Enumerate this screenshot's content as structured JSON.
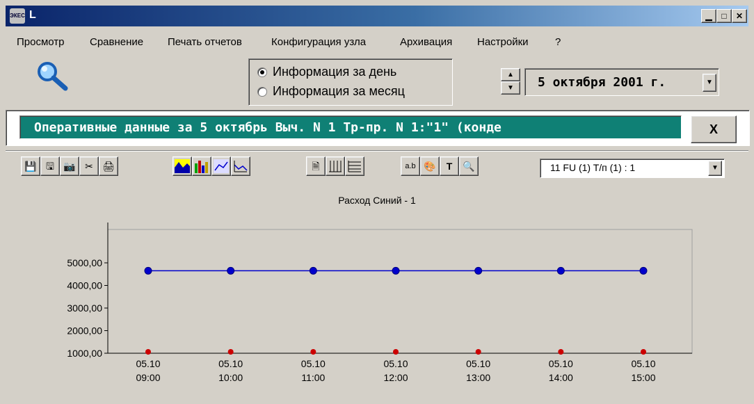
{
  "window": {
    "title": "L",
    "app_icon": "ЭКЕС"
  },
  "menu": [
    "Просмотр",
    "Сравнение",
    "Печать отчетов",
    "Конфигурация узла",
    "Архивация",
    "Настройки",
    "?"
  ],
  "period": {
    "options": [
      "Информация за день",
      "Информация за месяц"
    ],
    "selected": "Информация за день"
  },
  "date": {
    "value": "5  октября  2001 г."
  },
  "info": {
    "text": "Оперативные данные за 5 октябрь Выч. N 1 Тр-пр. N 1:\"1\" (конде",
    "close_label": "X"
  },
  "toolbar": {
    "icons": [
      "save-icon",
      "save-as-icon",
      "camera-icon",
      "scissors-icon",
      "print-icon",
      "area-chart-icon",
      "bar-chart-icon",
      "line-points-chart-icon",
      "line-chart-icon",
      "document-icon",
      "vertical-grid-icon",
      "horizontal-grid-icon",
      "text-label-icon",
      "palette-icon",
      "font-icon",
      "zoom-icon"
    ],
    "series_select": "11 FU (1) T/п (1) : 1"
  },
  "colors": {
    "info_bg": "#0f8075",
    "series_blue": "#0000cc",
    "series_red": "#cc0000",
    "plot_bg": "#d4d0c8"
  },
  "chart_data": {
    "type": "line",
    "title": "Расход   Синий - 1",
    "categories": [
      [
        "05.10",
        "09:00"
      ],
      [
        "05.10",
        "10:00"
      ],
      [
        "05.10",
        "11:00"
      ],
      [
        "05.10",
        "12:00"
      ],
      [
        "05.10",
        "13:00"
      ],
      [
        "05.10",
        "14:00"
      ],
      [
        "05.10",
        "15:00"
      ]
    ],
    "y_ticks": [
      "1000,00",
      "2000,00",
      "3000,00",
      "4000,00",
      "5000,00"
    ],
    "ylim": [
      1000,
      5000
    ],
    "series": [
      {
        "color": "#0000cc",
        "values": [
          4650,
          4650,
          4650,
          4650,
          4650,
          4650,
          4650
        ]
      },
      {
        "color": "#cc0000",
        "values": [
          1000,
          1000,
          1000,
          1000,
          1000,
          1000,
          1000
        ]
      }
    ],
    "grid": false
  }
}
